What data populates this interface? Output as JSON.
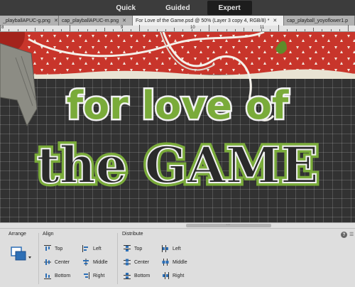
{
  "modes": [
    {
      "label": "Quick",
      "active": false
    },
    {
      "label": "Guided",
      "active": false
    },
    {
      "label": "Expert",
      "active": true
    }
  ],
  "tabs": [
    {
      "label": "_playballAPUC-g.png",
      "active": false
    },
    {
      "label": "cap_playballAPUC-m.png",
      "active": false
    },
    {
      "label": "For Love of the Game.psd @ 50% (Layer 3 copy 4, RGB/8) *",
      "active": true
    },
    {
      "label": "cap_playball_yoyoflower1.p",
      "active": false
    }
  ],
  "ruler": {
    "labels": [
      "8",
      "9",
      "10",
      "11"
    ]
  },
  "artwork": {
    "line1": "for love of",
    "line2": "the GAME",
    "colors": {
      "green": "#7aab3a",
      "red": "#c8352b",
      "dark": "#2a2a2a"
    }
  },
  "panel": {
    "arrange_title": "Arrange",
    "align_title": "Align",
    "distribute_title": "Distribute",
    "align": {
      "top": "Top",
      "center": "Center",
      "bottom": "Bottom",
      "left": "Left",
      "middle": "Middle",
      "right": "Right"
    },
    "distribute": {
      "top": "Top",
      "center": "Center",
      "bottom": "Bottom",
      "left": "Left",
      "middle": "Middle",
      "right": "Right"
    },
    "help": "?"
  }
}
